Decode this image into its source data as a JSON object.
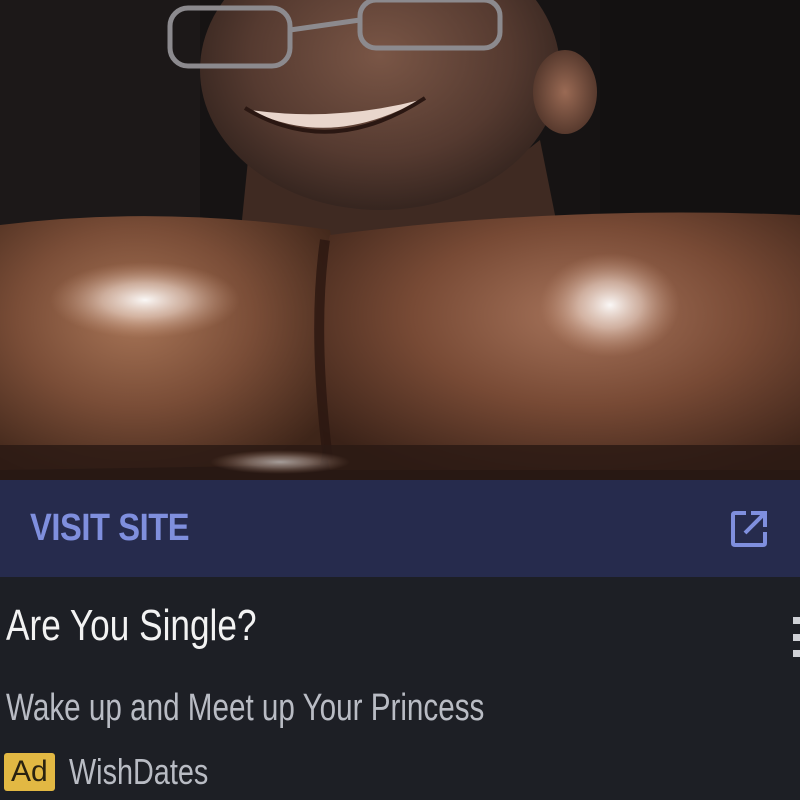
{
  "cta": {
    "label": "VISIT SITE",
    "icon": "external-link-icon"
  },
  "ad": {
    "headline": "Are You Single?",
    "description": "Wake up and Meet up Your Princess",
    "badge": "Ad",
    "advertiser": "WishDates",
    "menu_icon": "more-vertical-icon"
  },
  "colors": {
    "cta_background": "#262b4d",
    "cta_text": "#7f8fde",
    "ad_background": "#1d1f25",
    "headline_text": "#f2f2f2",
    "secondary_text": "#b9bcc4",
    "badge_background": "#e2b843"
  }
}
